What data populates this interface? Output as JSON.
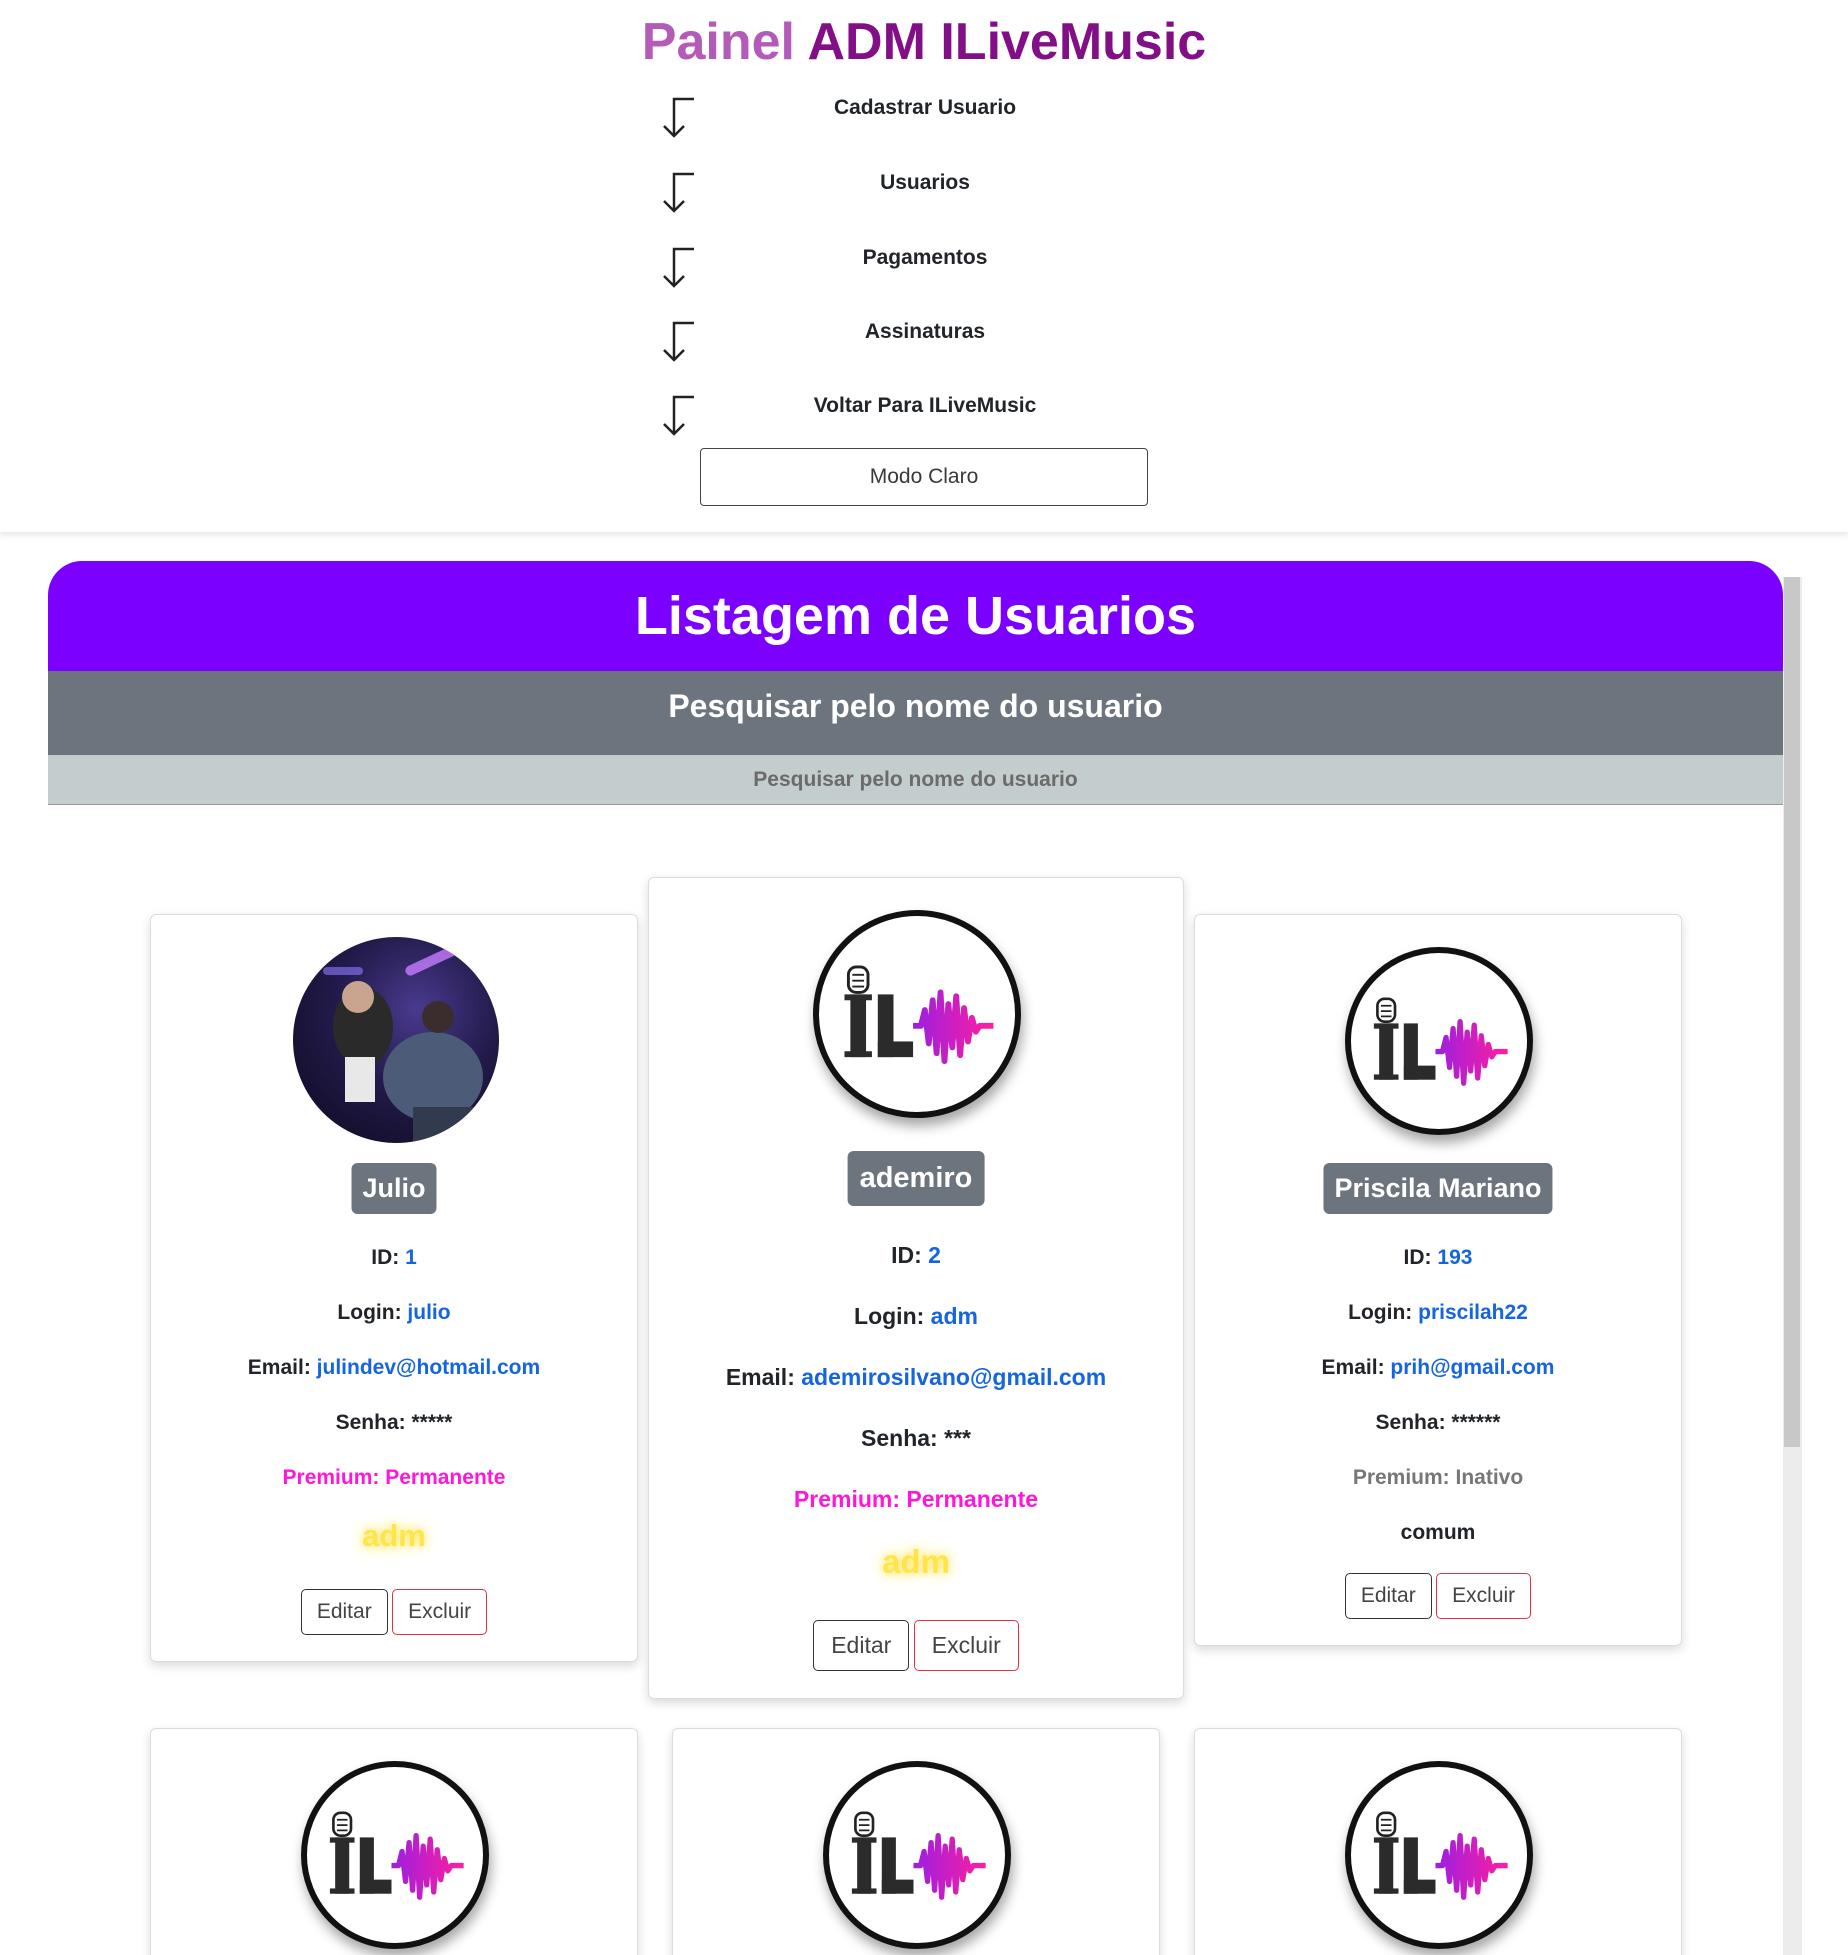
{
  "header": {
    "brand_part1": "Painel",
    "brand_part2": "ADM ILiveMusic",
    "nav": [
      {
        "label": "Cadastrar Usuario"
      },
      {
        "label": "Usuarios"
      },
      {
        "label": "Pagamentos"
      },
      {
        "label": "Assinaturas"
      },
      {
        "label": "Voltar Para ILiveMusic"
      }
    ],
    "theme_button": "Modo Claro"
  },
  "listing": {
    "title": "Listagem de Usuarios",
    "search_heading": "Pesquisar pelo nome do usuario",
    "search_placeholder": "Pesquisar pelo nome do usuario"
  },
  "labels": {
    "id": "ID:",
    "login": "Login:",
    "email": "Email:",
    "senha": "Senha:",
    "edit": "Editar",
    "delete": "Excluir"
  },
  "users": [
    {
      "name": "Julio",
      "id": "1",
      "login": "julio",
      "email": "julindev@hotmail.com",
      "senha": "*****",
      "premium": "Premium: Permanente",
      "role": "adm",
      "avatar": "photo-icon"
    },
    {
      "name": "ademiro",
      "id": "2",
      "login": "adm",
      "email": "ademirosilvano@gmail.com",
      "senha": "***",
      "premium": "Premium: Permanente",
      "role": "adm",
      "avatar": "ilivemusic-logo-icon"
    },
    {
      "name": "Priscila Mariano",
      "id": "193",
      "login": "priscilah22",
      "email": "prih@gmail.com",
      "senha": "******",
      "premium": "Premium: Inativo",
      "role": "comum",
      "avatar": "ilivemusic-logo-icon"
    }
  ],
  "colors": {
    "brand_light": "#b45ab9",
    "brand_dark": "#830f86",
    "listing_header": "#7c00ff",
    "search_bar": "#6c757d",
    "link_value": "#1565e0",
    "premium_active": "#ff17d8",
    "role_adm_glow": "#ffe54a",
    "delete_border": "#dc3545"
  }
}
